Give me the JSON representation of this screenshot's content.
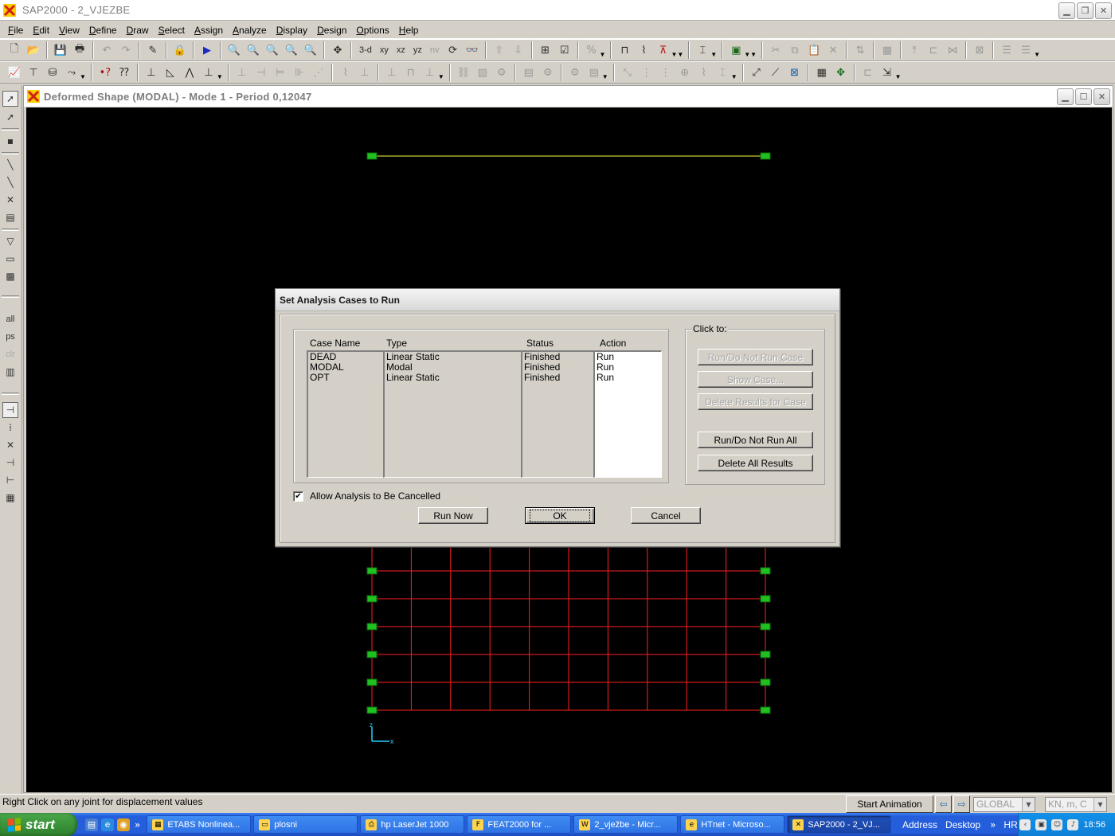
{
  "app": {
    "title": "SAP2000 - 2_VJEZBE",
    "icon": "sap2000-logo-icon"
  },
  "menu": [
    {
      "label": "File",
      "accel": "F",
      "rest": "ile"
    },
    {
      "label": "Edit",
      "accel": "E",
      "rest": "dit"
    },
    {
      "label": "View",
      "accel": "V",
      "rest": "iew"
    },
    {
      "label": "Define",
      "accel": "D",
      "rest": "efine"
    },
    {
      "label": "Draw",
      "accel": "D",
      "rest": "raw"
    },
    {
      "label": "Select",
      "accel": "S",
      "rest": "elect"
    },
    {
      "label": "Assign",
      "accel": "A",
      "rest": "ssign"
    },
    {
      "label": "Analyze",
      "accel": "A",
      "rest": "nalyze"
    },
    {
      "label": "Display",
      "accel": "D",
      "rest": "isplay"
    },
    {
      "label": "Design",
      "accel": "D",
      "rest": "esign"
    },
    {
      "label": "Options",
      "accel": "O",
      "rest": "ptions"
    },
    {
      "label": "Help",
      "accel": "H",
      "rest": "elp"
    }
  ],
  "toolbar": {
    "view_3d": "3-d",
    "view_xy": "xy",
    "view_xz": "xz",
    "view_yz": "yz",
    "view_nv": "nv"
  },
  "left_toolbar": {
    "all_label": "all",
    "ps_label": "ps",
    "clr_label": "clr"
  },
  "child_window": {
    "title": "Deformed Shape (MODAL) - Mode 1 - Period 0,12047"
  },
  "canvas": {
    "background": "#000000",
    "mesh_color": "#ff2020",
    "top_line_color": "#ffff40",
    "joint_color": "#20c020",
    "axis_color": "#20d0ff",
    "axis_x_label": "x",
    "axis_z_label": "z"
  },
  "dialog": {
    "title": "Set Analysis Cases to Run",
    "columns": {
      "case_name": "Case Name",
      "type": "Type",
      "status": "Status",
      "action": "Action"
    },
    "cases": [
      {
        "name": "DEAD",
        "type": "Linear Static",
        "status": "Finished",
        "action": "Run"
      },
      {
        "name": "MODAL",
        "type": "Modal",
        "status": "Finished",
        "action": "Run"
      },
      {
        "name": "OPT",
        "type": "Linear Static",
        "status": "Finished",
        "action": "Run"
      }
    ],
    "click_to_label": "Click to:",
    "buttons": {
      "run_do_not_run_case": "Run/Do Not Run Case",
      "show_case": "Show Case...",
      "delete_results_for_case": "Delete Results for Case",
      "run_do_not_run_all": "Run/Do Not Run All",
      "delete_all_results": "Delete All Results",
      "run_now": "Run Now",
      "ok": "OK",
      "cancel": "Cancel"
    },
    "allow_cancel": {
      "label": "Allow Analysis to Be Cancelled",
      "checked": true
    }
  },
  "statusbar": {
    "text": "Right Click on any joint for displacement values",
    "start_animation": "Start Animation",
    "coord_system": "GLOBAL",
    "units": "KN, m, C"
  },
  "taskbar": {
    "start_label": "start",
    "tasks": [
      {
        "label": "ETABS Nonlinea...",
        "icon": "etabs-icon"
      },
      {
        "label": "plosni",
        "icon": "folder-icon"
      },
      {
        "label": "hp LaserJet 1000",
        "icon": "printer-icon"
      },
      {
        "label": "FEAT2000 for ...",
        "icon": "feat-icon"
      },
      {
        "label": "2_vježbe - Micr...",
        "icon": "word-icon"
      },
      {
        "label": "HTnet - Microso...",
        "icon": "ie-icon"
      },
      {
        "label": "SAP2000 - 2_VJ...",
        "icon": "sap2000-icon",
        "active": true
      }
    ],
    "address_label": "Address",
    "desktop_label": "Desktop",
    "language": "HR",
    "clock": "18:56"
  }
}
